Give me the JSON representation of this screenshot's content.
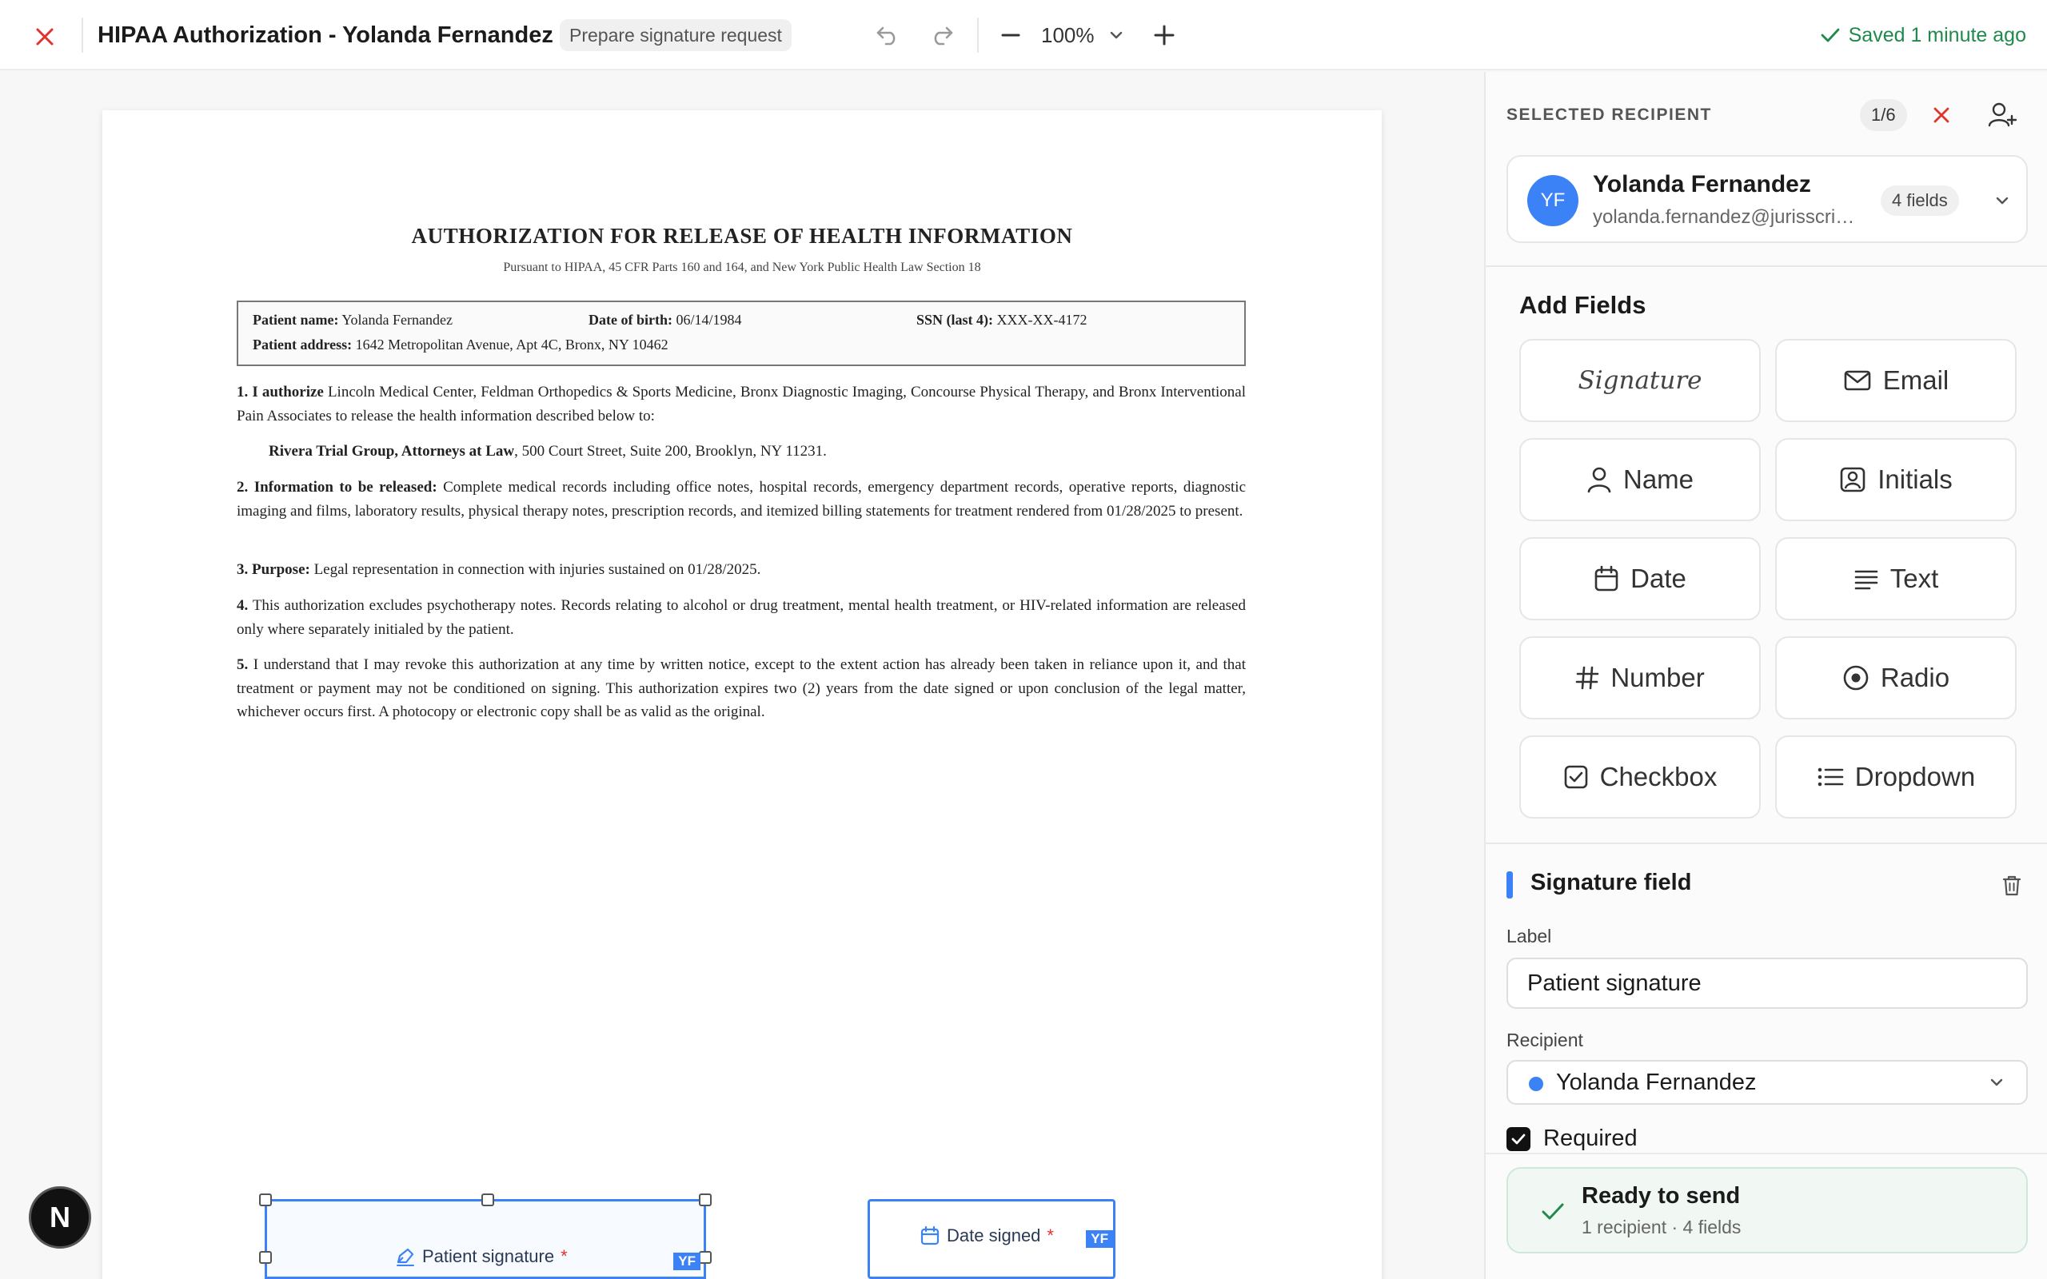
{
  "app": {
    "title": "HIPAA Authorization - Yolanda Fernandez",
    "status": "Prepare signature request",
    "zoom": "100%",
    "saved_text": "Saved 1 minute ago"
  },
  "document": {
    "heading": "AUTHORIZATION FOR RELEASE OF HEALTH INFORMATION",
    "subheading": "Pursuant to HIPAA, 45 CFR Parts 160 and 164, and New York Public Health Law Section 18",
    "patient": {
      "name_label": "Patient name:",
      "name": "Yolanda Fernandez",
      "dob_label": "Date of birth:",
      "dob": "06/14/1984",
      "ssn_label": "SSN (last 4):",
      "ssn": "XXX-XX-4172",
      "address_label": "Patient address:",
      "address": "1642 Metropolitan Avenue, Apt 4C, Bronx, NY 10462"
    },
    "p1_lead": "1. I authorize",
    "p1_text": "Lincoln Medical Center, Feldman Orthopedics & Sports Medicine, Bronx Diagnostic Imaging, Concourse Physical Therapy, and Bronx Interventional Pain Associates to release the health information described below to:",
    "recipient_firm": "Rivera Trial Group, Attorneys at Law",
    "recipient_address": ", 500 Court Street, Suite 200, Brooklyn, NY 11231.",
    "p2_lead": "2. Information to be released:",
    "p2_text": "Complete medical records including office notes, hospital records, emergency department records, operative reports, diagnostic imaging and films, laboratory results, physical therapy notes, prescription records, and itemized billing statements for treatment rendered from 01/28/2025 to present.",
    "p3_lead": "3. Purpose:",
    "p3_text": "Legal representation in connection with injuries sustained on 01/28/2025.",
    "p4_lead": "4.",
    "p4_text": "This authorization excludes psychotherapy notes. Records relating to alcohol or drug treatment, mental health treatment, or HIV-related information are released only where separately initialed by the patient.",
    "p5_lead": "5.",
    "p5_text": "I understand that I may revoke this authorization at any time by written notice, except to the extent action has already been taken in reliance upon it, and that treatment or payment may not be conditioned on signing. This authorization expires two (2) years from the date signed or upon conclusion of the legal matter, whichever occurs first. A photocopy or electronic copy shall be as valid as the original.",
    "placed_fields": [
      {
        "label": "Patient signature",
        "required_mark": "*",
        "owner": "YF",
        "icon": "signature-pen-icon"
      },
      {
        "label": "Date signed",
        "required_mark": "*",
        "owner": "YF",
        "icon": "calendar-icon"
      }
    ]
  },
  "badge": {
    "letter": "N"
  },
  "panel": {
    "section_label": "SELECTED RECIPIENT",
    "counter": "1/6",
    "recipient": {
      "initials": "YF",
      "name": "Yolanda Fernandez",
      "email": "yolanda.fernandez@jurisscribe.com",
      "fields_count": "4 fields"
    },
    "add_fields_title": "Add Fields",
    "field_types": [
      {
        "label": "Signature",
        "icon": "signature-icon"
      },
      {
        "label": "Email",
        "icon": "mail-icon"
      },
      {
        "label": "Name",
        "icon": "user-icon"
      },
      {
        "label": "Initials",
        "icon": "id-badge-icon"
      },
      {
        "label": "Date",
        "icon": "calendar-icon"
      },
      {
        "label": "Text",
        "icon": "lines-icon"
      },
      {
        "label": "Number",
        "icon": "hash-icon"
      },
      {
        "label": "Radio",
        "icon": "radio-icon"
      },
      {
        "label": "Checkbox",
        "icon": "checkbox-icon"
      },
      {
        "label": "Dropdown",
        "icon": "list-icon"
      }
    ],
    "selected_field": {
      "title": "Signature field",
      "label_caption": "Label",
      "label_value": "Patient signature",
      "recipient_caption": "Recipient",
      "recipient_value": "Yolanda Fernandez",
      "required_label": "Required",
      "required_checked": true
    },
    "ready": {
      "title": "Ready to send",
      "subtitle": "1 recipient · 4 fields"
    }
  },
  "colors": {
    "accent": "#3b82f6",
    "success": "#1f8a4c",
    "danger": "#e0332c"
  }
}
